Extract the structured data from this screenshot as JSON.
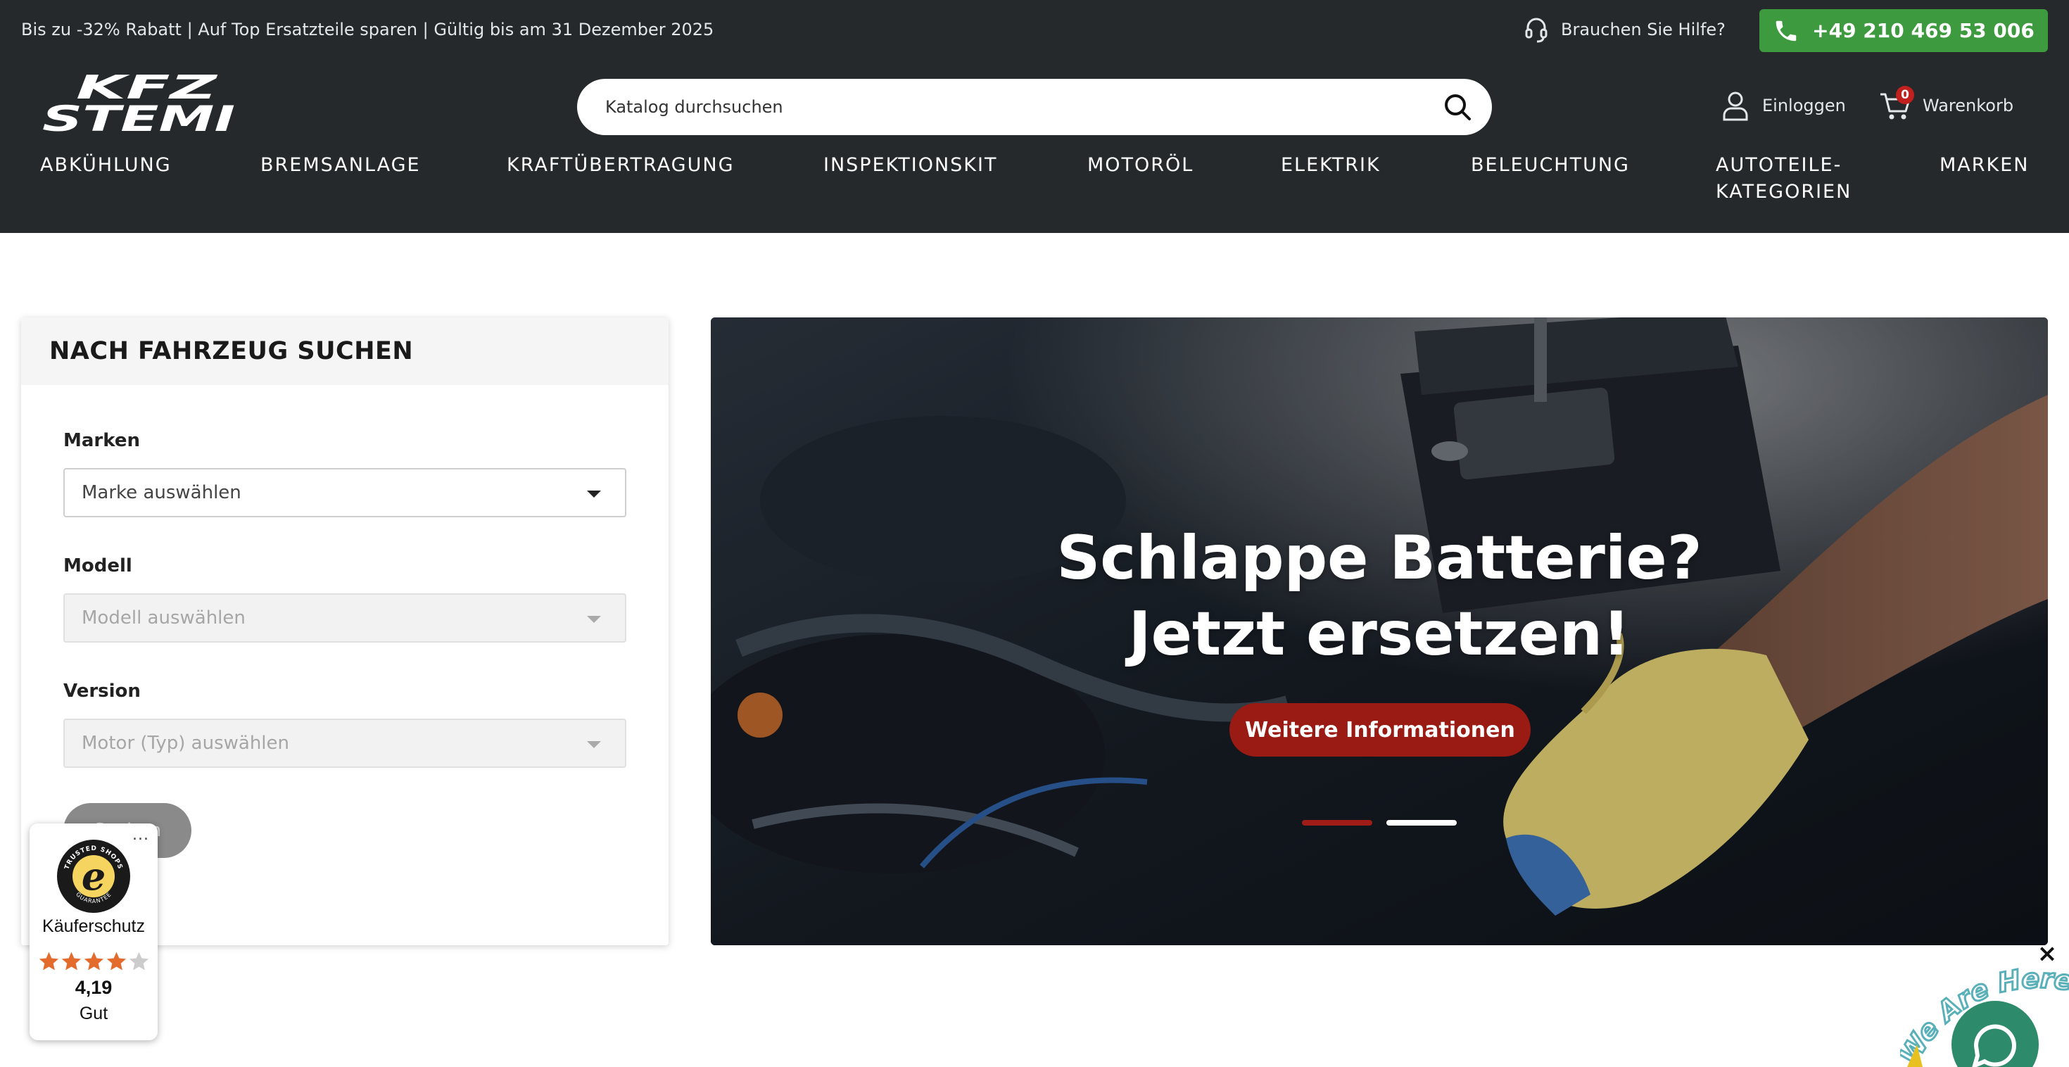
{
  "topbar": {
    "promo": "Bis zu -32% Rabatt | Auf Top Ersatzteile sparen | Gültig bis am 31 Dezember 2025",
    "help_label": "Brauchen Sie Hilfe?",
    "phone": "+49 210 469 53 006"
  },
  "header": {
    "logo_text": "KFZ STEMI",
    "search_placeholder": "Katalog durchsuchen",
    "login_label": "Einloggen",
    "cart_label": "Warenkorb",
    "cart_count": "0"
  },
  "nav": {
    "items": [
      {
        "label": "ABKÜHLUNG"
      },
      {
        "label": "BREMSANLAGE"
      },
      {
        "label": "KRAFTÜBERTRAGUNG"
      },
      {
        "label": "INSPEKTIONSKIT"
      },
      {
        "label": "MOTORÖL"
      },
      {
        "label": "ELEKTRIK"
      },
      {
        "label": "BELEUCHTUNG"
      },
      {
        "label": "AUTOTEILE-\nKATEGORIEN"
      },
      {
        "label": "MARKEN"
      }
    ]
  },
  "vehicle_search": {
    "title": "NACH FAHRZEUG SUCHEN",
    "brand_label": "Marken",
    "brand_value": "Marke auswählen",
    "model_label": "Modell",
    "model_value": "Modell auswählen",
    "version_label": "Version",
    "version_value": "Motor (Typ) auswählen",
    "submit_label": "Suchen"
  },
  "hero": {
    "title_line1": "Schlappe Batterie?",
    "title_line2": "Jetzt ersetzen!",
    "button_label": "Weitere Informationen",
    "slide_count": 2,
    "active_slide": 1
  },
  "trusted_shops": {
    "seal_text": "TRUSTED SHOPS GUARANTEE",
    "label": "Käuferschutz",
    "rating": 4.19,
    "rating_text": "4,19",
    "grade": "Gut",
    "more": "..."
  },
  "chat": {
    "close": "×",
    "tagline": "We Are Here!"
  },
  "colors": {
    "header_bg": "#25292c",
    "phone_green": "#3e9a3e",
    "hero_button": "#9a1a14",
    "star": "#e36b2c"
  }
}
